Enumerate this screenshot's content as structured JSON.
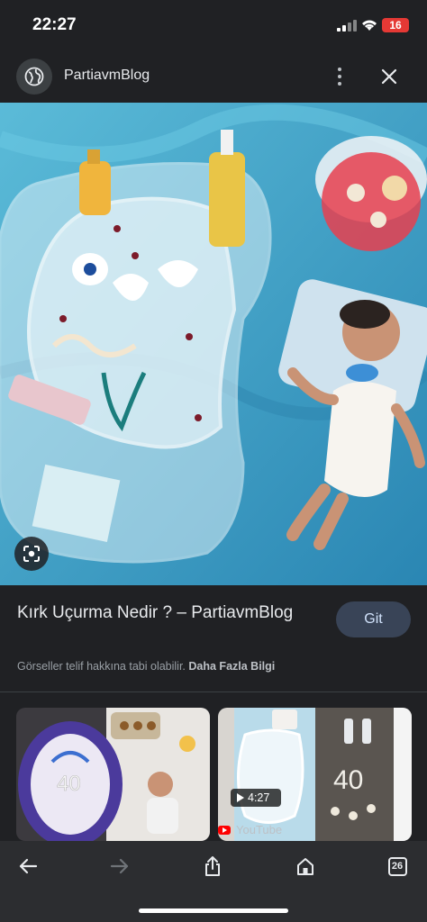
{
  "status": {
    "time": "22:27",
    "battery": "16"
  },
  "header": {
    "title": "PartiavmBlog",
    "site_icon": "globe-icon",
    "menu_icon": "more-vert-icon",
    "close_icon": "close-icon"
  },
  "hero": {
    "alt": "",
    "lens_icon": "lens-icon"
  },
  "result": {
    "title": "Kırk Uçurma Nedir ? – PartiavmBlog",
    "go_label": "Git",
    "copyright_text": "Görseller telif hakkına tabi olabilir.",
    "more_info_label": "Daha Fazla Bilgi"
  },
  "related": {
    "items": [
      {
        "source": "",
        "duration": ""
      },
      {
        "source": "YouTube",
        "duration": "4:27"
      }
    ]
  },
  "toolbar": {
    "back_icon": "back-arrow-icon",
    "forward_icon": "forward-arrow-icon",
    "share_icon": "share-icon",
    "home_icon": "home-icon",
    "tabs_count": "26"
  },
  "colors": {
    "background": "#202124",
    "accent_button": "#394457",
    "battery": "#e53935"
  }
}
